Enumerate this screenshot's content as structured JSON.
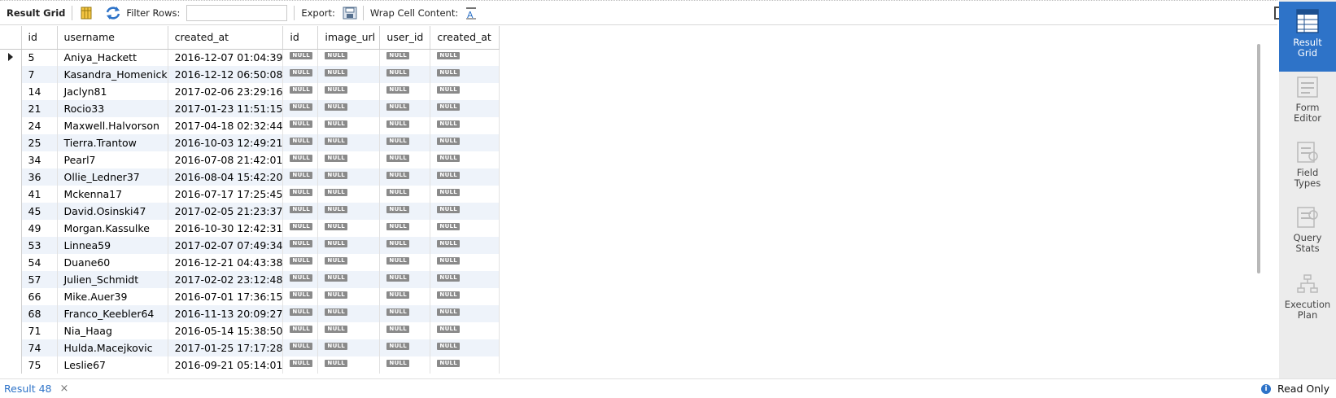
{
  "toolbar": {
    "result_grid_label": "Result Grid",
    "filter_rows_label": "Filter Rows:",
    "filter_value": "",
    "export_label": "Export:",
    "wrap_label": "Wrap Cell Content:"
  },
  "grid": {
    "columns": [
      "id",
      "username",
      "created_at",
      "id",
      "image_url",
      "user_id",
      "created_at"
    ],
    "null_label": "NULL",
    "rows": [
      {
        "id": "5",
        "username": "Aniya_Hackett",
        "created_at": "2016-12-07 01:04:39"
      },
      {
        "id": "7",
        "username": "Kasandra_Homenick",
        "created_at": "2016-12-12 06:50:08"
      },
      {
        "id": "14",
        "username": "Jaclyn81",
        "created_at": "2017-02-06 23:29:16"
      },
      {
        "id": "21",
        "username": "Rocio33",
        "created_at": "2017-01-23 11:51:15"
      },
      {
        "id": "24",
        "username": "Maxwell.Halvorson",
        "created_at": "2017-04-18 02:32:44"
      },
      {
        "id": "25",
        "username": "Tierra.Trantow",
        "created_at": "2016-10-03 12:49:21"
      },
      {
        "id": "34",
        "username": "Pearl7",
        "created_at": "2016-07-08 21:42:01"
      },
      {
        "id": "36",
        "username": "Ollie_Ledner37",
        "created_at": "2016-08-04 15:42:20"
      },
      {
        "id": "41",
        "username": "Mckenna17",
        "created_at": "2016-07-17 17:25:45"
      },
      {
        "id": "45",
        "username": "David.Osinski47",
        "created_at": "2017-02-05 21:23:37"
      },
      {
        "id": "49",
        "username": "Morgan.Kassulke",
        "created_at": "2016-10-30 12:42:31"
      },
      {
        "id": "53",
        "username": "Linnea59",
        "created_at": "2017-02-07 07:49:34"
      },
      {
        "id": "54",
        "username": "Duane60",
        "created_at": "2016-12-21 04:43:38"
      },
      {
        "id": "57",
        "username": "Julien_Schmidt",
        "created_at": "2017-02-02 23:12:48"
      },
      {
        "id": "66",
        "username": "Mike.Auer39",
        "created_at": "2016-07-01 17:36:15"
      },
      {
        "id": "68",
        "username": "Franco_Keebler64",
        "created_at": "2016-11-13 20:09:27"
      },
      {
        "id": "71",
        "username": "Nia_Haag",
        "created_at": "2016-05-14 15:38:50"
      },
      {
        "id": "74",
        "username": "Hulda.Macejkovic",
        "created_at": "2017-01-25 17:17:28"
      },
      {
        "id": "75",
        "username": "Leslie67",
        "created_at": "2016-09-21 05:14:01"
      }
    ]
  },
  "side_panel": {
    "items": [
      {
        "label": "Result\nGrid",
        "icon": "result-grid-icon"
      },
      {
        "label": "Form\nEditor",
        "icon": "form-editor-icon"
      },
      {
        "label": "Field\nTypes",
        "icon": "field-types-icon"
      },
      {
        "label": "Query\nStats",
        "icon": "query-stats-icon"
      },
      {
        "label": "Execution\nPlan",
        "icon": "execution-plan-icon"
      }
    ]
  },
  "status": {
    "tab_label": "Result 48",
    "tab_close": "×",
    "readonly_label": "Read Only",
    "info_glyph": "i"
  },
  "colors": {
    "accent": "#2e73c8",
    "null_badge": "#8a8a8a",
    "row_alt": "#eef3fa"
  }
}
